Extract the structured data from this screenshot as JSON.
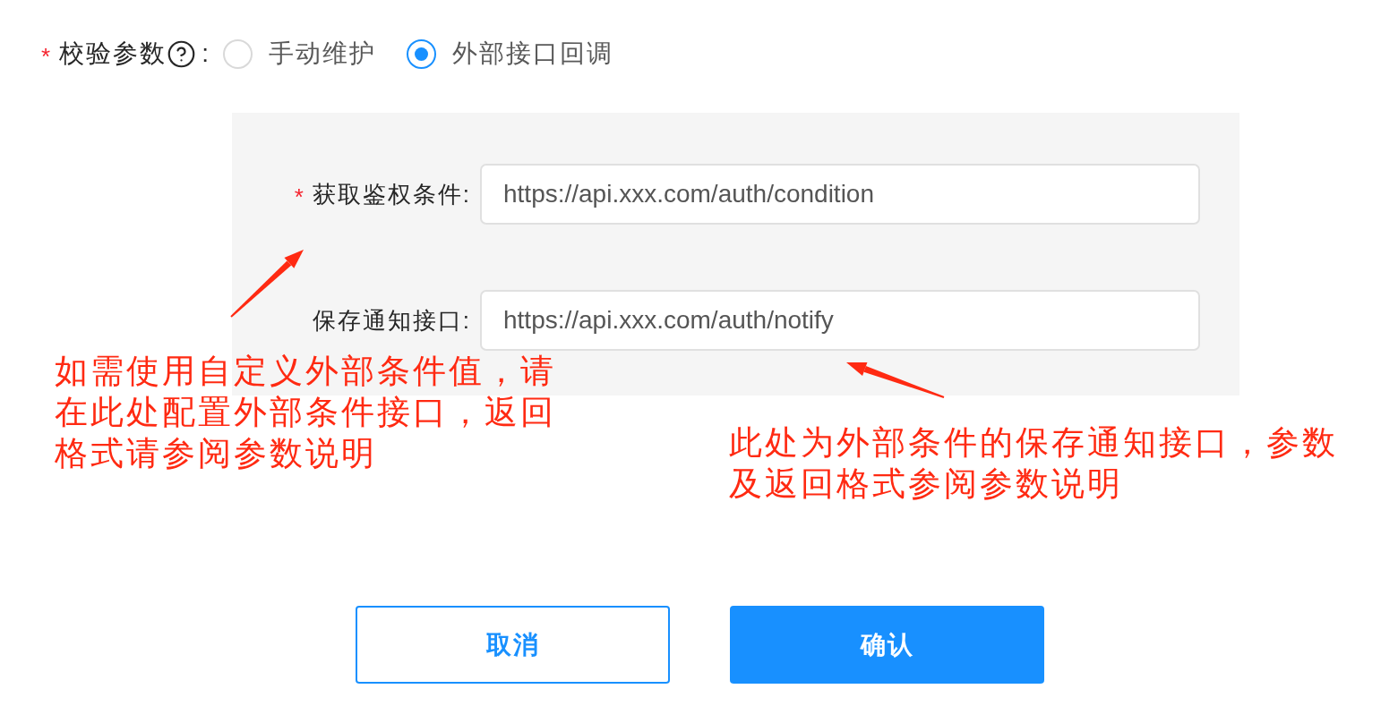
{
  "verify_params": {
    "required_mark": "*",
    "label": "校验参数",
    "label_end": ":",
    "options": [
      {
        "label": "手动维护",
        "selected": false
      },
      {
        "label": "外部接口回调",
        "selected": true
      }
    ]
  },
  "callback_panel": {
    "fields": [
      {
        "required_mark": "*",
        "label": "获取鉴权条件:",
        "value": "https://api.xxx.com/auth/condition"
      },
      {
        "label": "保存通知接口:",
        "value": "https://api.xxx.com/auth/notify"
      }
    ]
  },
  "annotations": [
    {
      "text": "如需使用自定义外部条件值，请在此处配置外部条件接口，返回格式请参阅参数说明"
    },
    {
      "text": "此处为外部条件的保存通知接口，参数及返回格式参阅参数说明"
    }
  ],
  "buttons": [
    {
      "label": "取消",
      "kind": "secondary"
    },
    {
      "label": "确认",
      "kind": "primary"
    }
  ]
}
